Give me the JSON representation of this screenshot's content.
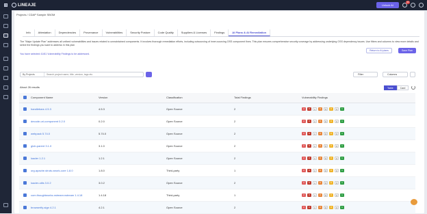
{
  "topbar": {
    "brand": "LINEAJE",
    "unlock_label": "Unlock AI",
    "notif_count": "99"
  },
  "breadcrumb": "Projects / CDAP Sample SBOM",
  "tabs": [
    {
      "label": "Info"
    },
    {
      "label": "Attestation"
    },
    {
      "label": "Dependencies"
    },
    {
      "label": "Provenance"
    },
    {
      "label": "Vulnerabilities"
    },
    {
      "label": "Security Posture"
    },
    {
      "label": "Code Quality"
    },
    {
      "label": "Suppliers & Licenses"
    },
    {
      "label": "Findings"
    },
    {
      "label": "AI Plans & AI Remediation",
      "active": true
    }
  ],
  "description": "The \"Major Update Plan\" addresses all unfixed vulnerabilities and issues related to unmaintained components. It involves thorough remediation efforts, including outsourcing of inner-sourcing OSS component fixes. This plan ensures comprehensive security coverage by addressing underlying OSS dependency issues. Use filters and columns to view more details and select the findings you want to address in this plan",
  "selection_text": "You have selected 41/61 Vulnerability Findings to be addressed.",
  "return_label": "Return to AI plans",
  "save_label": "Save Plan",
  "search": {
    "scope": "By Projects",
    "placeholder": "Search project name, title, version, tags etc."
  },
  "filter_label": "Filter",
  "columns_label": "Columns",
  "results_count": "About 26 results",
  "view_toggle": {
    "table": "Table",
    "card": "Card"
  },
  "table": {
    "headers": [
      "Component Name",
      "Version",
      "Classification",
      "Total Findings",
      "Vulnerability Findings"
    ],
    "rows": [
      {
        "name": "handlebars 4.5.3",
        "version": "4.5.3",
        "class": "Open Source",
        "total": "2"
      },
      {
        "name": "decode-uri-component 0.2.0",
        "version": "0.2.0",
        "class": "Open Source",
        "total": "2"
      },
      {
        "name": "webpack 5.74.0",
        "version": "5.74.0",
        "class": "Open Source",
        "total": "2"
      },
      {
        "name": "glob-parent 3.1.0",
        "version": "3.1.0",
        "class": "Open Source",
        "total": "2"
      },
      {
        "name": "loader 1.2.1",
        "version": "1.2.1",
        "class": "Open Source",
        "total": "2"
      },
      {
        "name": "org.apache.struts.xwork-core 1.8.0",
        "version": "1.8.0",
        "class": "Third-party",
        "total": "1"
      },
      {
        "name": "loader-utils 3.0.2",
        "version": "3.0.2",
        "class": "Open Source",
        "total": "2"
      },
      {
        "name": "com.thoughtworks.xstream:xstream 1.4.18",
        "version": "1.4.18",
        "class": "Third-party",
        "total": "1"
      },
      {
        "name": "browserify-sign 4.2.1",
        "version": "4.2.1",
        "class": "Open Source",
        "total": "2"
      }
    ],
    "vuln_colors": [
      "#e05a5a",
      "#c0392b",
      "#ffffff",
      "#e8863a",
      "#f0f0f0",
      "#f0b429",
      "#f5f5f5",
      "#2f9e44"
    ],
    "vuln_counts": [
      "2",
      "0",
      "0",
      "0",
      "0",
      "0",
      "0",
      "1"
    ]
  }
}
